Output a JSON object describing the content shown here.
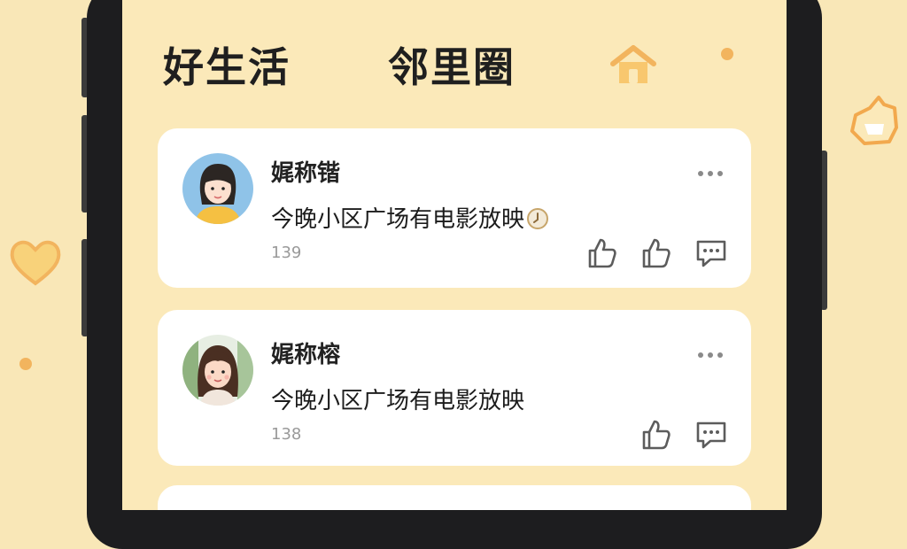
{
  "header": {
    "title_left": "好生活",
    "title_right": "邻里圈"
  },
  "posts": [
    {
      "username": "娓称锴",
      "text": "今晚小区广场有电影放映",
      "count": "139",
      "avatar_icon": "avatar-woman-short-hair"
    },
    {
      "username": "娓称榕",
      "text": "今晚小区广场有电影放映",
      "count": "138",
      "avatar_icon": "avatar-woman-long-hair"
    }
  ],
  "colors": {
    "background": "#f9e7b7",
    "card": "#ffffff",
    "accent": "#f2b45e",
    "icon_gray": "#6b6b6b"
  }
}
